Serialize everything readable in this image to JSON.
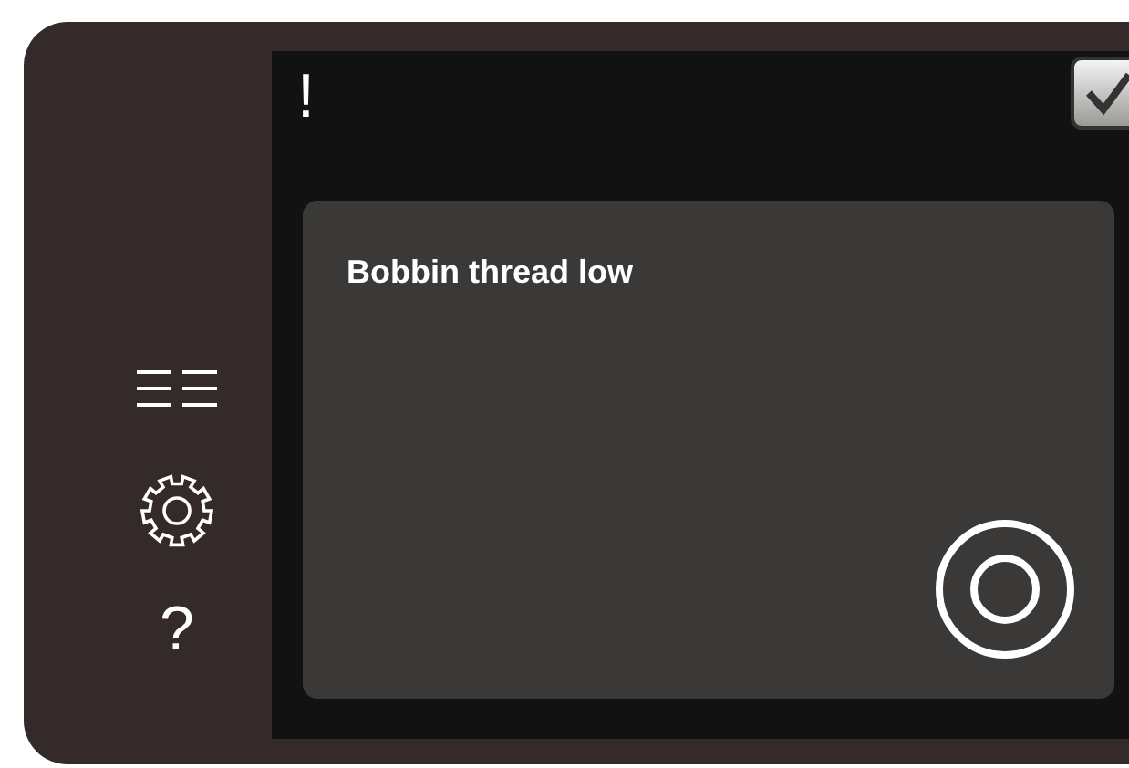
{
  "sidebar": {
    "help_button": "?"
  },
  "header": {
    "alert_mark": "!"
  },
  "message": {
    "text": "Bobbin thread low"
  }
}
